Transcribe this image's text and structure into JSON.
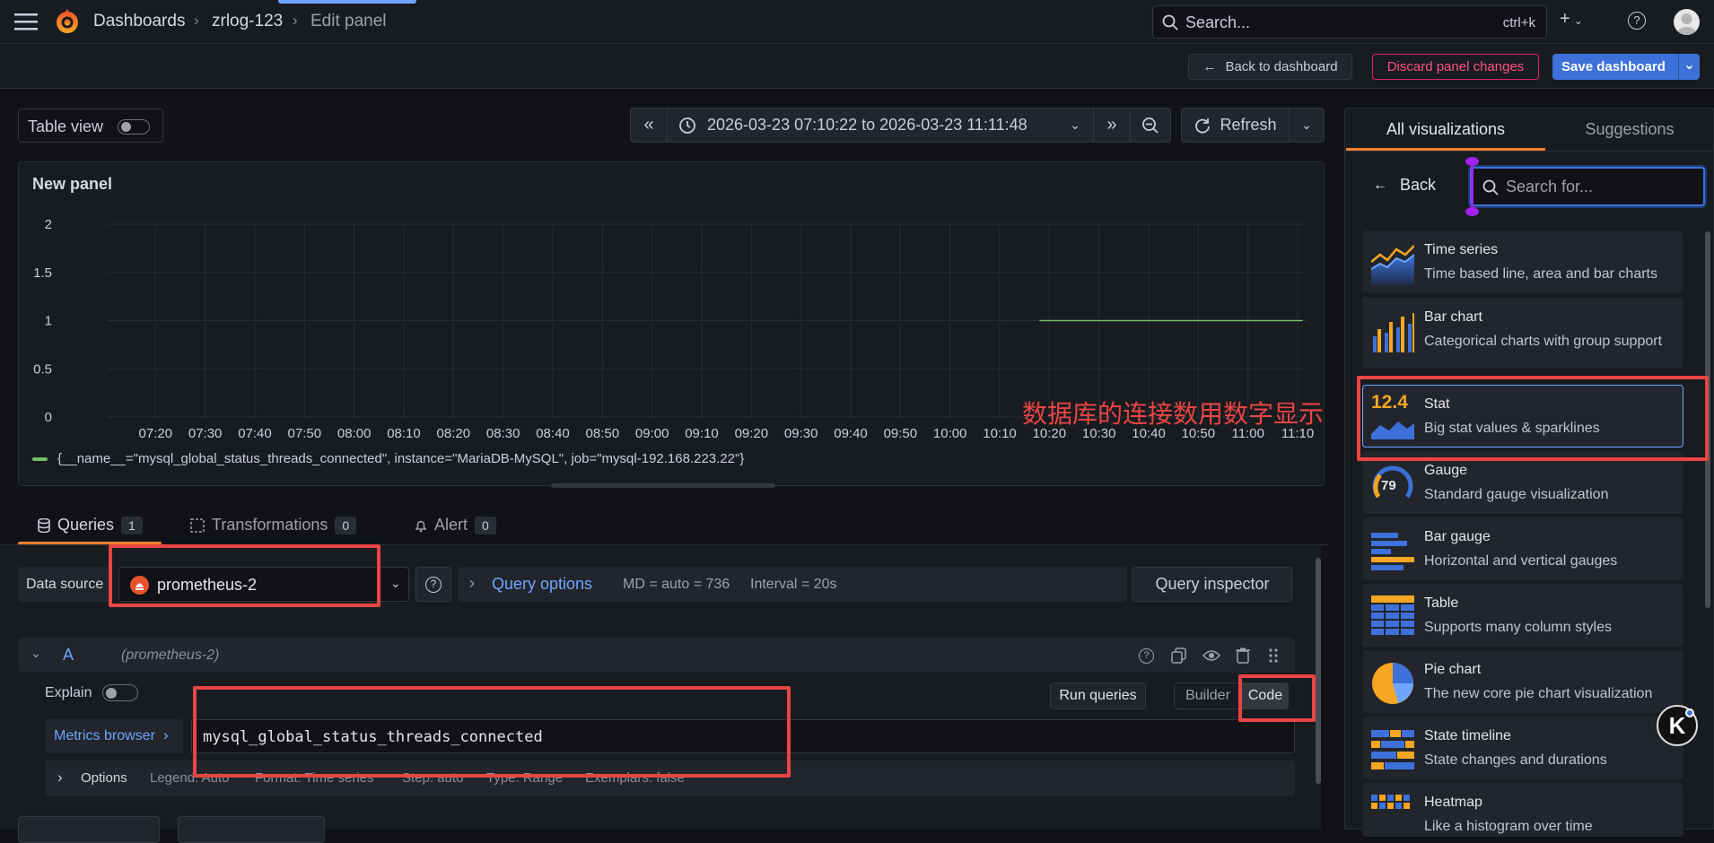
{
  "breadcrumbs": [
    "Dashboards",
    "zrlog-123",
    "Edit panel"
  ],
  "search": {
    "placeholder": "Search...",
    "shortcut": "ctrl+k"
  },
  "toolbar": {
    "back_label": "Back to dashboard",
    "discard_label": "Discard panel changes",
    "save_label": "Save dashboard"
  },
  "controls": {
    "table_view_label": "Table view",
    "time_range": "2026-03-23 07:10:22 to 2026-03-23 11:11:48",
    "refresh_label": "Refresh"
  },
  "panel": {
    "title": "New panel",
    "legend": "{__name__=\"mysql_global_status_threads_connected\", instance=\"MariaDB-MySQL\", job=\"mysql-192.168.223.22\"}"
  },
  "chart_data": {
    "type": "line",
    "title": "New panel",
    "x_ticks": [
      "07:20",
      "07:30",
      "07:40",
      "07:50",
      "08:00",
      "08:10",
      "08:20",
      "08:30",
      "08:40",
      "08:50",
      "09:00",
      "09:10",
      "09:20",
      "09:30",
      "09:40",
      "09:50",
      "10:00",
      "10:10",
      "10:20",
      "10:30",
      "10:40",
      "10:50",
      "11:00",
      "11:10"
    ],
    "y_ticks": [
      "0",
      "0.5",
      "1",
      "1.5",
      "2"
    ],
    "ylim": [
      0,
      2
    ],
    "xlim": [
      "07:10:22",
      "11:11:48"
    ],
    "series": [
      {
        "x": [
          "10:18",
          "11:11"
        ],
        "values": [
          1,
          1
        ],
        "color": "#73bf69"
      }
    ],
    "grid": true,
    "legend_position": "bottom"
  },
  "tabs": [
    {
      "label": "Queries",
      "count": "1"
    },
    {
      "label": "Transformations",
      "count": "0"
    },
    {
      "label": "Alert",
      "count": "0"
    }
  ],
  "query": {
    "datasource_label": "Data source",
    "datasource": "prometheus-2",
    "options_label": "Query options",
    "md": "MD = auto = 736",
    "interval": "Interval = 20s",
    "inspector_label": "Query inspector",
    "ref_id": "A",
    "ref_source": "(prometheus-2)",
    "explain_label": "Explain",
    "run_label": "Run queries",
    "builder_label": "Builder",
    "code_label": "Code",
    "metrics_label": "Metrics browser",
    "expr": "mysql_global_status_threads_connected",
    "options_row": {
      "label": "Options",
      "legend": "Legend: Auto",
      "format": "Format: Time series",
      "step": "Step: auto",
      "type": "Type: Range",
      "exemplars": "Exemplars: false"
    }
  },
  "sidebar": {
    "tab_all": "All visualizations",
    "tab_suggestions": "Suggestions",
    "back_label": "Back",
    "search_placeholder": "Search for...",
    "stat_number": "12.4",
    "gauge_number": "79",
    "items": [
      {
        "name": "Time series",
        "desc": "Time based line, area and bar charts"
      },
      {
        "name": "Bar chart",
        "desc": "Categorical charts with group support"
      },
      {
        "name": "Stat",
        "desc": "Big stat values & sparklines"
      },
      {
        "name": "Gauge",
        "desc": "Standard gauge visualization"
      },
      {
        "name": "Bar gauge",
        "desc": "Horizontal and vertical gauges"
      },
      {
        "name": "Table",
        "desc": "Supports many column styles"
      },
      {
        "name": "Pie chart",
        "desc": "The new core pie chart visualization"
      },
      {
        "name": "State timeline",
        "desc": "State changes and durations"
      },
      {
        "name": "Heatmap",
        "desc": "Like a histogram over time"
      }
    ]
  },
  "annotation": "数据库的连接数用数字显示"
}
